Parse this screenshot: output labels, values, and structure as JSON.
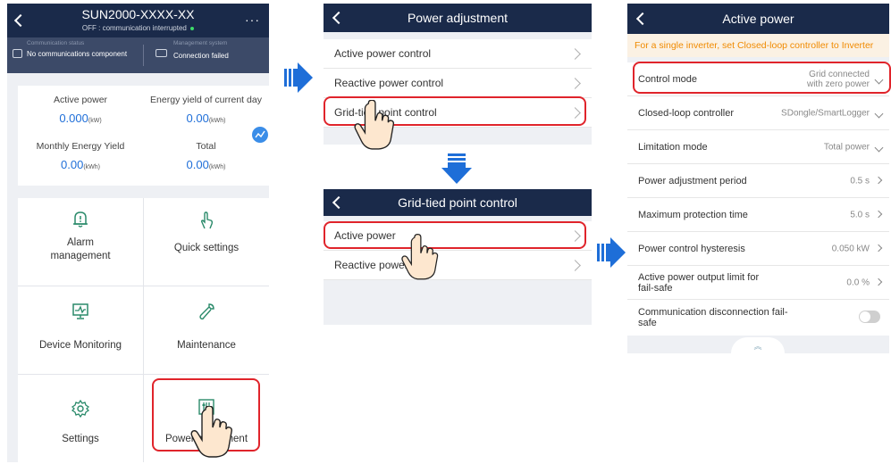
{
  "panel1": {
    "title": "SUN2000-XXXX-XX",
    "subtitle": "OFF : communication interrupted",
    "status_left_label": "Communication status",
    "status_left_value": "No communications component",
    "status_right_label": "Management system",
    "status_right_value": "Connection failed",
    "stats": [
      {
        "label": "Active power",
        "value": "0.000",
        "unit": "(kW)"
      },
      {
        "label": "Energy yield of current day",
        "value": "0.00",
        "unit": "(kWh)"
      },
      {
        "label": "Monthly Energy Yield",
        "value": "0.00",
        "unit": "(kWh)"
      },
      {
        "label": "Total",
        "value": "0.00",
        "unit": "(kWh)"
      }
    ],
    "tiles": [
      {
        "label": "Alarm management"
      },
      {
        "label": "Quick settings"
      },
      {
        "label": "Device Monitoring"
      },
      {
        "label": "Maintenance"
      },
      {
        "label": "Settings"
      },
      {
        "label": "Power adjustment"
      }
    ]
  },
  "panel2": {
    "title": "Power adjustment",
    "items": [
      "Active power control",
      "Reactive power control",
      "Grid-tied point control"
    ]
  },
  "panel3": {
    "title": "Grid-tied point control",
    "items": [
      "Active power",
      "Reactive power"
    ]
  },
  "panel4": {
    "title": "Active power",
    "banner": "For a single inverter, set Closed-loop controller to Inverter",
    "rows": [
      {
        "label": "Control mode",
        "value": "Grid connected with zero power"
      },
      {
        "label": "Closed-loop controller",
        "value": "SDongle/SmartLogger"
      },
      {
        "label": "Limitation mode",
        "value": "Total power"
      },
      {
        "label": "Power adjustment period",
        "value": "0.5 s"
      },
      {
        "label": "Maximum protection time",
        "value": "5.0 s"
      },
      {
        "label": "Power control hysteresis",
        "value": "0.050 kW"
      },
      {
        "label": "Active power output limit for fail-safe",
        "value": "0.0 %"
      },
      {
        "label": "Communication disconnection fail-safe",
        "value": ""
      }
    ]
  },
  "colors": {
    "header": "#1a2a4a",
    "accent": "#1e6ed8",
    "highlight": "#e0242b",
    "banner_text": "#f08a00",
    "arrow": "#1e6ed8"
  }
}
